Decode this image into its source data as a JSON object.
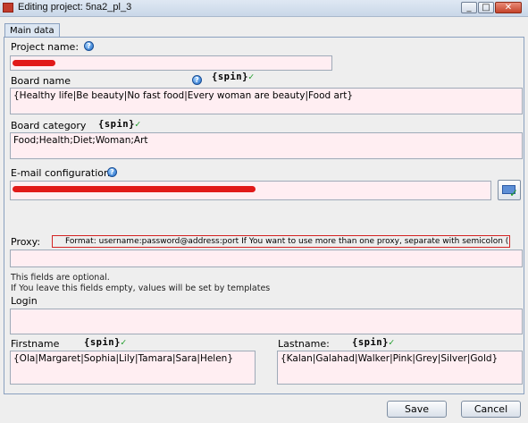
{
  "window": {
    "title": "Editing project: 5na2_pl_3",
    "minimize": "_",
    "maximize": "□",
    "close": "✕"
  },
  "tabs": [
    "Main data"
  ],
  "help_icon": "?",
  "spin_tag": "{spin}",
  "spin_checkmark": "✓",
  "project_name": {
    "label": "Project name:",
    "value": ""
  },
  "board_name": {
    "label": "Board name",
    "value": "{Healthy life|Be beauty|No fast food|Every woman are beauty|Food art}"
  },
  "board_category": {
    "label": "Board category",
    "value": "Food;Health;Diet;Woman;Art"
  },
  "email_configuration": {
    "label": "E-mail configuration:",
    "value": ""
  },
  "proxy": {
    "label": "Proxy:",
    "hint": "Format: username:password@address:port      If You want to use more than one proxy, separate with semicolon (\";\")",
    "value": ""
  },
  "optional_note": {
    "line1": "This fields are optional.",
    "line2": "If You leave this fields empty, values will be set by templates"
  },
  "login": {
    "label": "Login",
    "value": ""
  },
  "firstname": {
    "label": "Firstname",
    "value": "{Ola|Margaret|Sophia|Lily|Tamara|Sara|Helen}"
  },
  "lastname": {
    "label": "Lastname:",
    "value": "{Kalan|Galahad|Walker|Pink|Grey|Silver|Gold}"
  },
  "buttons": {
    "save": "Save",
    "cancel": "Cancel"
  },
  "colors": {
    "field_bg": "#ffeef2",
    "redaction": "#e11919",
    "spin_check": "#1f9d2a",
    "hint_border": "#d32323"
  },
  "icons": [
    "app-icon",
    "help-icon",
    "email-check-icon"
  ]
}
